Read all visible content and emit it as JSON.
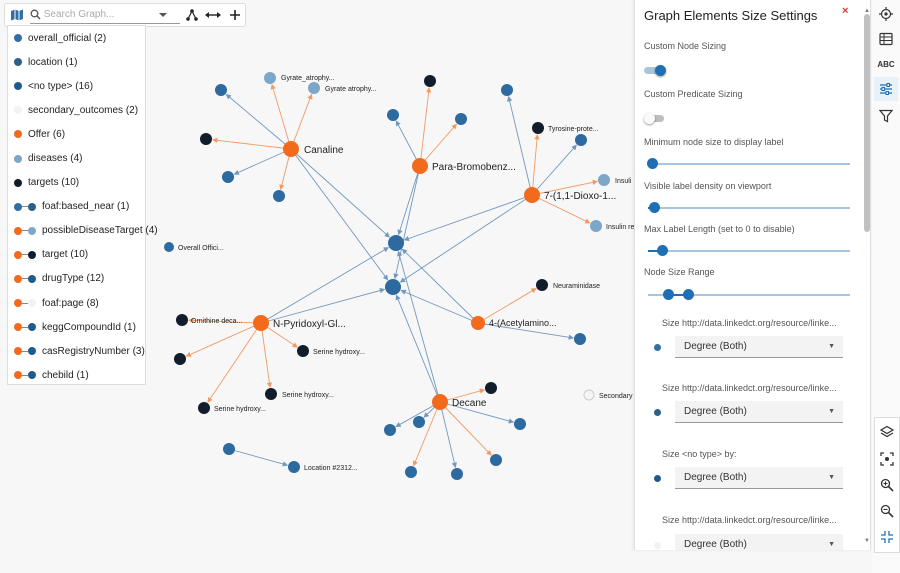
{
  "search": {
    "placeholder": "Search Graph..."
  },
  "legend": {
    "items": [
      {
        "kind": "node",
        "label": "overall_official (2)",
        "color": "#2f6fa3"
      },
      {
        "kind": "node",
        "label": "location (1)",
        "color": "#2e5f87"
      },
      {
        "kind": "node",
        "label": "<no type> (16)",
        "color": "#1f5a8d"
      },
      {
        "kind": "node",
        "label": "secondary_outcomes (2)",
        "color": "#f2f2f2"
      },
      {
        "kind": "node",
        "label": "Offer (6)",
        "color": "#f26b1d"
      },
      {
        "kind": "node",
        "label": "diseases (4)",
        "color": "#7ea6c8"
      },
      {
        "kind": "node",
        "label": "targets (10)",
        "color": "#111d2b"
      },
      {
        "kind": "pred",
        "label": "foaf:based_near (1)",
        "from": "#2f6fa3",
        "to": "#2e5f87"
      },
      {
        "kind": "pred",
        "label": "possibleDiseaseTarget (4)",
        "from": "#f26b1d",
        "to": "#7ea6c8"
      },
      {
        "kind": "pred",
        "label": "target (10)",
        "from": "#f26b1d",
        "to": "#111d2b"
      },
      {
        "kind": "pred",
        "label": "drugType (12)",
        "from": "#f26b1d",
        "to": "#1f5a8d"
      },
      {
        "kind": "pred",
        "label": "foaf:page (8)",
        "from": "#f26b1d",
        "to": "#f2f2f2"
      },
      {
        "kind": "pred",
        "label": "keggCompoundId (1)",
        "from": "#f26b1d",
        "to": "#1f5a8d"
      },
      {
        "kind": "pred",
        "label": "casRegistryNumber (3)",
        "from": "#f26b1d",
        "to": "#1f5a8d"
      },
      {
        "kind": "pred",
        "label": "chebild (1)",
        "from": "#f26b1d",
        "to": "#1f5a8d"
      }
    ]
  },
  "panel": {
    "title": "Graph Elements Size Settings",
    "close_label": "×",
    "custom_node_sizing": {
      "label": "Custom Node Sizing",
      "on": true
    },
    "custom_predicate_sizing": {
      "label": "Custom Predicate Sizing",
      "on": false
    },
    "min_node_size": {
      "label": "Minimum node size to display label",
      "value": 0.02
    },
    "label_density": {
      "label": "Visible label density on viewport",
      "value": 0.03
    },
    "max_label_length": {
      "label": "Max Label Length (set to 0 to disable)",
      "value": 0.07
    },
    "node_size_range": {
      "label": "Node Size Range",
      "low": 0.1,
      "high": 0.2
    },
    "size_by": [
      {
        "label": "Size http://data.linkedct.org/resource/linke...",
        "value": "Degree (Both)",
        "color": "#2f6fa3"
      },
      {
        "label": "Size http://data.linkedct.org/resource/linke...",
        "value": "Degree (Both)",
        "color": "#2e5f87"
      },
      {
        "label": "Size <no type> by:",
        "value": "Degree (Both)",
        "color": "#1f5a8d"
      },
      {
        "label": "Size http://data.linkedct.org/resource/linke...",
        "value": "Degree (Both)",
        "color": "#f2f2f2"
      }
    ]
  },
  "graph_labels": {
    "canaline": "Canaline",
    "para": "Para-Bromobenz...",
    "dioxo": "7-(1,1-Dioxo-1...",
    "pyridoxyl": "N-Pyridoxyl-Gl...",
    "acetylamino": "4-(Acetylamino...",
    "decane": "Decane",
    "gyrate1": "Gyrate_atrophy...",
    "gyrate2": "Gyrate atrophy...",
    "tyrosine": "Tyrosine-prote...",
    "insulin1": "Insuli",
    "insulin2": "Insulin re",
    "overall": "Overall Offici...",
    "neuraminidase": "Neuraminidase",
    "ornithine": "Ornithine deca...",
    "serine1": "Serine hydroxy...",
    "serine2": "Serine hydroxy...",
    "serine3": "Serine hydroxy...",
    "secondary": "Secondary",
    "location": "Location #2312..."
  },
  "colors": {
    "offer": "#f26b1d",
    "notype": "#2d6aa0",
    "target": "#111d2b",
    "disease": "#7ea6c8",
    "accent": "#1f6fb4"
  },
  "icons": {
    "map": "map-icon",
    "search": "search-icon",
    "dropdown": "chevron-down-icon",
    "hierarchy": "hierarchy-icon",
    "expand": "horizontal-arrows-icon",
    "add": "plus-icon",
    "target": "crosshair-icon",
    "table": "table-icon",
    "abc": "abc-text-icon",
    "sliders": "sliders-icon",
    "filter": "filter-icon",
    "layers": "layers-icon",
    "fit": "fit-view-icon",
    "zoomin": "zoom-in-icon",
    "zoomout": "zoom-out-icon",
    "collapse": "collapse-icon"
  }
}
